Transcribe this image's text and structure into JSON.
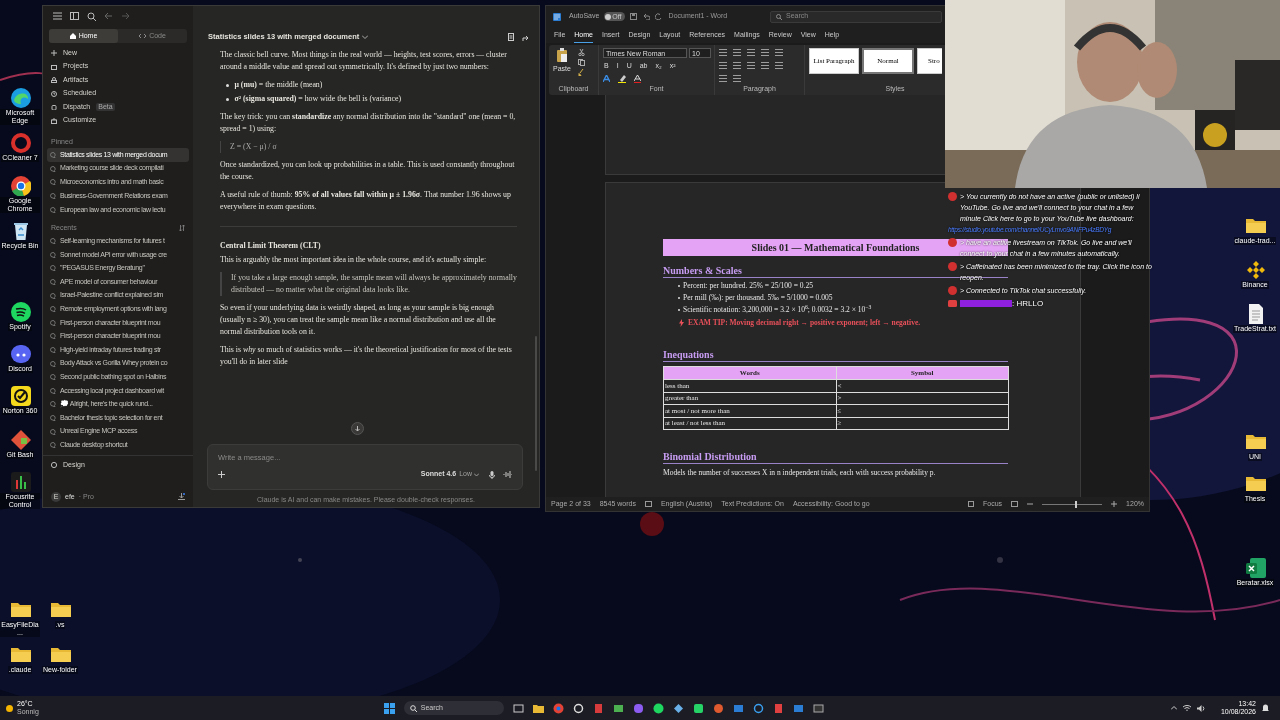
{
  "desktop_icons_left": [
    {
      "label": "Microsoft Edge",
      "kind": "edge"
    },
    {
      "label": "CCleaner 7",
      "kind": "ccleaner"
    },
    {
      "label": "Google Chrome",
      "kind": "chrome"
    },
    {
      "label": "Recycle Bin",
      "kind": "bin"
    },
    {
      "label": "Spotify",
      "kind": "spotify"
    },
    {
      "label": "Discord",
      "kind": "discord"
    },
    {
      "label": "Norton 360",
      "kind": "norton"
    },
    {
      "label": "Git Bash",
      "kind": "gitbash"
    },
    {
      "label": "Focusrite Control",
      "kind": "focusrite"
    },
    {
      "label": "EasyFileDia...",
      "kind": "folder"
    },
    {
      "label": ".claude",
      "kind": "folder"
    },
    {
      "label": ".vs",
      "kind": "folder"
    },
    {
      "label": "New-folder",
      "kind": "folder"
    }
  ],
  "desktop_icons_right": [
    {
      "label": "claude-trad...",
      "kind": "folder"
    },
    {
      "label": "Binance",
      "kind": "binance"
    },
    {
      "label": "TradeStrat.txt",
      "kind": "txt"
    },
    {
      "label": "UNI",
      "kind": "folder"
    },
    {
      "label": "Thesis",
      "kind": "folder"
    },
    {
      "label": "Beratar.xlsx",
      "kind": "xlsx"
    }
  ],
  "claude": {
    "tabs": [
      {
        "label": "Home",
        "selected": true
      },
      {
        "label": "Code",
        "selected": false
      }
    ],
    "nav": [
      {
        "label": "New",
        "kind": "plus"
      },
      {
        "label": "Projects",
        "kind": "box"
      },
      {
        "label": "Artifacts",
        "kind": "shapes"
      },
      {
        "label": "Scheduled",
        "kind": "clock"
      },
      {
        "label": "Dispatch",
        "kind": "bag",
        "badge": "Beta"
      },
      {
        "label": "Customize",
        "kind": "case"
      }
    ],
    "pinned_title": "Pinned",
    "pinned": [
      {
        "label": "Statistics slides 13 with merged docum",
        "selected": true
      },
      {
        "label": "Marketing course slide deck compilati",
        "selected": false
      },
      {
        "label": "Microeconomics intro and math basic",
        "selected": false
      },
      {
        "label": "Business-Government Relations exam",
        "selected": false
      },
      {
        "label": "European law and economic law lectu",
        "selected": false
      }
    ],
    "recents_title": "Recents",
    "recents": [
      "Self-learning mechanisms for futures t",
      "Sonnet model API error with usage cre",
      "\"PEGASUS Energy Beratung\"",
      "APE model of consumer behaviour",
      "Israel-Palestine conflict explained sim",
      "Remote employment options with lang",
      "First-person character blueprint mou",
      "First-person character blueprint mou",
      "High-yield intraday futures trading str",
      "Body Attack vs Gorilla Whey protein co",
      "Second public bathing spot on Halbins",
      "Accessing local project dashboard wit",
      "💭 Alright, here's the quick rund...",
      "Bachelor thesis topic selection for ent",
      "Unreal Engine MCP access",
      "Claude desktop shortcut"
    ],
    "design": "Design",
    "user": {
      "initial": "E",
      "name": "efe",
      "plan": "· Pro"
    },
    "chat_title": "Statistics slides 13 with merged document",
    "blocks": [
      {
        "kind": "p",
        "text": "The classic bell curve. Most things in the real world — heights, test scores, errors — cluster around a middle value and spread out symmetrically. It's defined by just two numbers:"
      },
      {
        "kind": "bullets",
        "items": [
          "**μ (mu)** = the middle (mean)",
          "**σ² (sigma squared)** = how wide the bell is (variance)"
        ]
      },
      {
        "kind": "p",
        "text": "The key trick: you can **standardize** any normal distribution into the \"standard\" one (mean = 0, spread = 1) using:"
      },
      {
        "kind": "formula",
        "text": "Z = (X − μ) / σ"
      },
      {
        "kind": "p",
        "text": "Once standardized, you can look up probabilities in a table. This is used constantly throughout the course."
      },
      {
        "kind": "p",
        "text": "A useful rule of thumb: **95% of all values fall within μ ± 1.96σ**. That number 1.96 shows up everywhere in exam questions."
      },
      {
        "kind": "rule"
      },
      {
        "kind": "heading",
        "text": "Central Limit Theorem (CLT)"
      },
      {
        "kind": "p",
        "text": "This is arguably the most important idea in the whole course, and it's actually simple:"
      },
      {
        "kind": "quote",
        "text": "If you take a large enough sample, the sample mean will always be approximately normally distributed — no matter what the original data looks like."
      },
      {
        "kind": "p",
        "text": "So even if your underlying data is weirdly shaped, as long as your sample is big enough (usually n ≥ 30), you can treat the sample mean like a normal distribution and use all the normal distribution tools on it."
      },
      {
        "kind": "p",
        "text": "This is *why* so much of statistics works — it's the theoretical justification for most of the tests you'll do in later slide"
      }
    ],
    "input_placeholder": "Write a message...",
    "model": "Sonnet 4.6",
    "effort": "Low",
    "disclaimer": "Claude is AI and can make mistakes. Please double-check responses."
  },
  "word": {
    "autosave": "AutoSave",
    "autosave_state": "Off",
    "title": "Document1 - Word",
    "search": "Search",
    "menu": [
      {
        "label": "File",
        "selected": false
      },
      {
        "label": "Home",
        "selected": true
      },
      {
        "label": "Insert",
        "selected": false
      },
      {
        "label": "Design",
        "selected": false
      },
      {
        "label": "Layout",
        "selected": false
      },
      {
        "label": "References",
        "selected": false
      },
      {
        "label": "Mailings",
        "selected": false
      },
      {
        "label": "Review",
        "selected": false
      },
      {
        "label": "View",
        "selected": false
      },
      {
        "label": "Help",
        "selected": false
      }
    ],
    "paste": "Paste",
    "font": "Times New Roman",
    "size": "10",
    "font_buttons": [
      "B",
      "I",
      "U",
      "ab",
      "x₂",
      "x²"
    ],
    "styles": [
      {
        "label": "List Paragraph",
        "selected": false
      },
      {
        "label": "Normal",
        "selected": true
      },
      {
        "label": "Stro",
        "selected": false
      }
    ],
    "groups": [
      "Clipboard",
      "Font",
      "Paragraph",
      "Styles"
    ],
    "doc": {
      "title": "Slides 01 — Mathematical Foundations",
      "sec1": "Numbers & Scales",
      "bullets": [
        "Percent: per hundred. 25% = 25/100 = 0.25",
        "Per mill (‰): per thousand. 5‰ = 5/1000 = 0.005",
        "Scientific notation: 3,200,000 = 3.2 × 10$^{6}$; 0.0032 = 3.2 × 10$^{−3}$"
      ],
      "tip": "EXAM TIP: Moving decimal right → positive exponent; left → negative.",
      "sec2": "Inequations",
      "table": {
        "columns": [
          "Words",
          "Symbol"
        ],
        "rows": [
          [
            "less than",
            "<"
          ],
          [
            "greater than",
            ">"
          ],
          [
            "at most / not more than",
            "≤"
          ],
          [
            "at least / not less than",
            "≥"
          ]
        ]
      },
      "sec3": "Binomial Distribution",
      "binom": "Models the number of successes X in n independent trials, each with success probability p."
    },
    "status": {
      "page": "Page 2 of 33",
      "words": "8545 words",
      "language": "English (Austria)",
      "predictions": "Text Predictions: On",
      "accessibility": "Accessibility: Good to go",
      "focus": "Focus",
      "zoom": "120%",
      "zoom_slider": {
        "level": 0.55
      }
    }
  },
  "chat_overlay": [
    {
      "kind": "system",
      "text": "> You currently do not have an active (public or unlisted) li YouTube. Go live and we'll connect to your chat in a few minute Click here to go to your YouTube live dashboard:",
      "link": "https://studio.youtube.com/channel/UCyLmvo9ANFPu4zBDYg"
    },
    {
      "kind": "system",
      "text": "> have an active livestream on TikTok. Go live and we'll connect to your chat in a few minutes automatically."
    },
    {
      "kind": "system",
      "text": "> Caffeinated has been minimized to the tray. Click the icon to reopen."
    },
    {
      "kind": "system",
      "text": "> Connected to TikTok chat successfully."
    },
    {
      "kind": "user",
      "text": ": HRLLO"
    }
  ],
  "taskbar": {
    "temp": "26°C",
    "weather": "Sonnig",
    "search": "Search",
    "time": "13:42",
    "date": "10/08/2026"
  }
}
